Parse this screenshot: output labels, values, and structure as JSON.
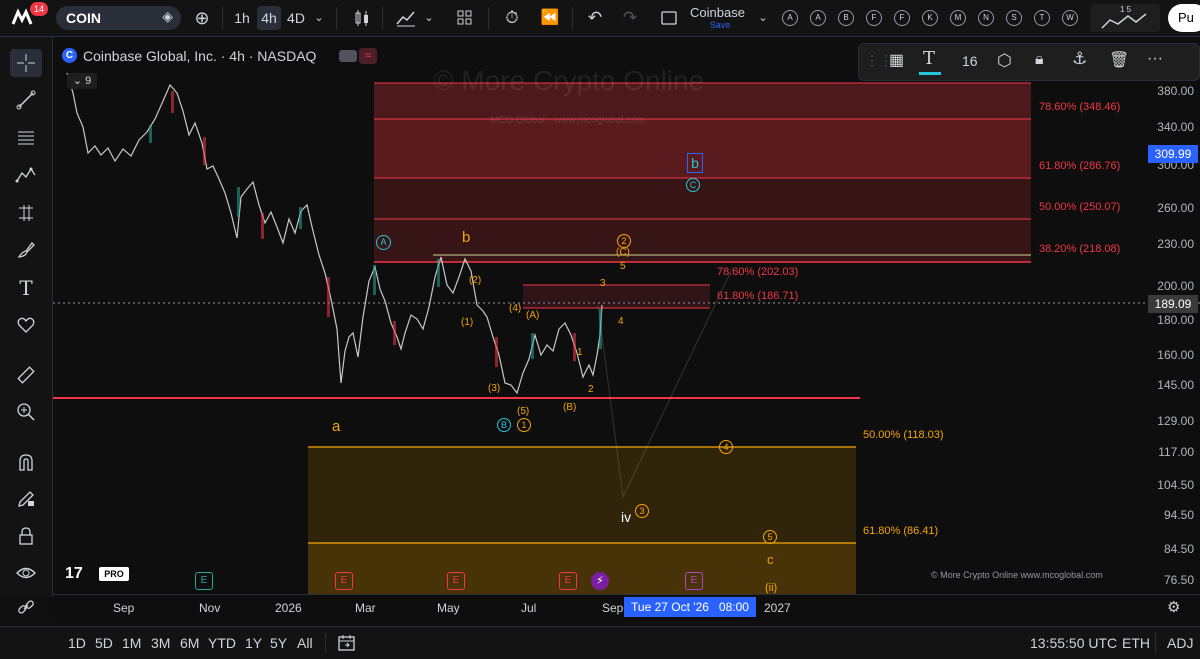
{
  "topbar": {
    "notif_count": "14",
    "symbol": "COIN",
    "timeframes": [
      "1h",
      "4h",
      "4D"
    ],
    "active_timeframe": "4h",
    "layout_name": "Coinbase",
    "save_label": "Save",
    "alert_letters": [
      "A",
      "A",
      "B",
      "F",
      "F",
      "K",
      "M",
      "N",
      "S",
      "T",
      "W"
    ],
    "publish_label": "Pu",
    "indicator_top": "1 5"
  },
  "legend": {
    "title": "Coinbase Global, Inc. · 4h · NASDAQ",
    "indicator_count": "9"
  },
  "drawing_toolbar": {
    "font_size": "16"
  },
  "watermark": {
    "line1": "© More Crypto Online",
    "line2": "MCO Global - www.mcoglobal.com",
    "footer": "© More Crypto Online   www.mcoglobal.com"
  },
  "price_axis": {
    "labels": [
      "380.00",
      "340.00",
      "300.00",
      "260.00",
      "230.00",
      "200.00",
      "180.00",
      "160.00",
      "145.00",
      "129.00",
      "117.00",
      "104.50",
      "94.50",
      "84.50",
      "76.50"
    ],
    "badge_high": "309.99",
    "badge_last": "189.09"
  },
  "fib_labels": {
    "f1": "78.60% (348.46)",
    "f2": "61.80% (286.76)",
    "f3": "50.00% (250.07)",
    "f4": "38.20% (218.08)",
    "f5": "78.60% (202.03)",
    "f6": "61.80% (186.71)",
    "f7": "50.00% (118.03)",
    "f8": "61.80% (86.41)"
  },
  "waves": {
    "A": "A",
    "b_upper": "b",
    "a": "a",
    "B": "B",
    "b_box": "b",
    "C": "C",
    "w2": "2",
    "wC": "(C)",
    "w5": "5",
    "w3": "3",
    "w4": "4",
    "w1p": "(1)",
    "w2p": "(2)",
    "w3p": "(3)",
    "w4p": "(4)",
    "w5p": "(5)",
    "wAp": "(A)",
    "wBp": "(B)",
    "c1": "1",
    "s1": "1",
    "s2": "2",
    "iv": "iv",
    "c3": "3",
    "c4": "4",
    "c5": "5",
    "c": "c",
    "ii": "(ii)"
  },
  "time_axis": {
    "labels": [
      "Sep",
      "Nov",
      "2026",
      "Mar",
      "May",
      "Jul",
      "Sep",
      "2027"
    ],
    "cursor": "Tue 27 Oct '26   08:00"
  },
  "bottom": {
    "ranges": [
      "1D",
      "5D",
      "1M",
      "3M",
      "6M",
      "YTD",
      "1Y",
      "5Y",
      "All"
    ],
    "clock": "13:55:50 UTC",
    "currency": "ETH",
    "adj": "ADJ"
  },
  "logo": {
    "text": "PRO"
  },
  "colors": {
    "fib_red": "#f23645",
    "fib_orange": "#f7a600",
    "accent_blue": "#2962ff",
    "wave_cyan": "#26c6da"
  }
}
